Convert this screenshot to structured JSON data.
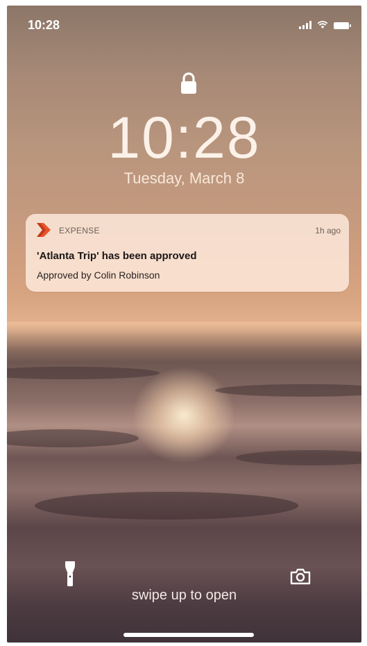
{
  "status_bar": {
    "time": "10:28"
  },
  "lock_screen": {
    "time": "10:28",
    "date": "Tuesday, March 8"
  },
  "notification": {
    "app_name": "EXPENSE",
    "time_ago": "1h ago",
    "title": "'Atlanta Trip' has been approved",
    "body": "Approved by Colin Robinson",
    "app_icon": "expense-chevron-icon",
    "accent_color": "#e8542a"
  },
  "bottom": {
    "swipe_text": "swipe up to open",
    "left_icon": "flashlight-icon",
    "right_icon": "camera-icon"
  },
  "colors": {
    "text_on_wallpaper": "#ffffff",
    "notification_bg": "#ffece0"
  }
}
